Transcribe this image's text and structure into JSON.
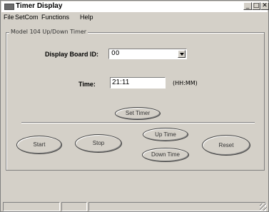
{
  "window": {
    "title": "Timer Display",
    "minimize": "_",
    "maximize": "□",
    "close": "✕"
  },
  "menu": [
    "File",
    "SetCom",
    "Functions",
    "Help"
  ],
  "group": {
    "label": "Model 104 Up/Down Timer"
  },
  "display_board": {
    "label": "Display Board ID:",
    "value": "00"
  },
  "time": {
    "label": "Time:",
    "value": "21:11",
    "format": "(HH:MM)"
  },
  "buttons": {
    "set_timer": "Set Timer",
    "start": "Start",
    "stop": "Stop",
    "up_time": "Up Time",
    "down_time": "Down Time",
    "reset": "Reset"
  }
}
